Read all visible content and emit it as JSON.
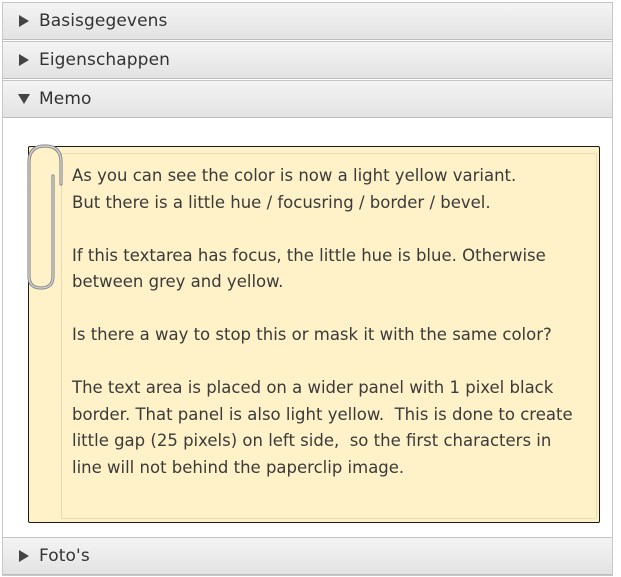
{
  "accordion": {
    "panes": [
      {
        "title": "Basisgegevens",
        "expanded": false,
        "arrow_icon": "triangle-right-icon"
      },
      {
        "title": "Eigenschappen",
        "expanded": false,
        "arrow_icon": "triangle-right-icon"
      },
      {
        "title": "Memo",
        "expanded": true,
        "arrow_icon": "triangle-down-icon"
      },
      {
        "title": "Foto's",
        "expanded": false,
        "arrow_icon": "triangle-right-icon"
      }
    ]
  },
  "memo": {
    "text": "As you can see the color is now a light yellow variant.\nBut there is a little hue / focusring / border / bevel.\n\nIf this textarea has focus, the little hue is blue. Otherwise between grey and yellow.\n\nIs there a way to stop this or mask it with the same color?\n\nThe text area is placed on a wider panel with 1 pixel black border. That panel is also light yellow.  This is done to create little gap (25 pixels) on left side,  so the first characters in line will not behind the paperclip image.",
    "decoration_icon": "paperclip-icon"
  },
  "colors": {
    "memo_background": "#fff2c8",
    "panel_border": "#1a1a1a",
    "header_background": "#e9e9e9"
  }
}
